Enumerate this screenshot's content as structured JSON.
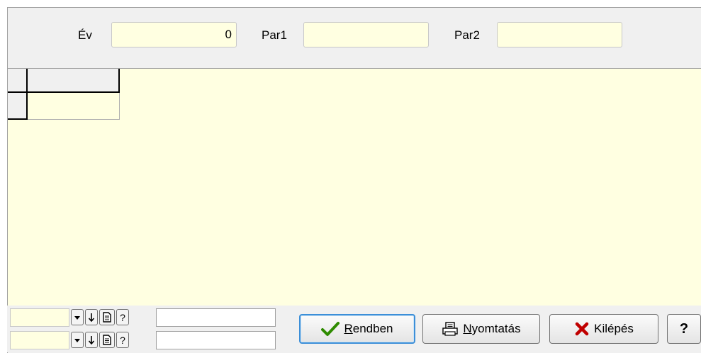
{
  "filters": {
    "ev_label": "Év",
    "ev_value": "0",
    "par1_label": "Par1",
    "par1_value": "",
    "par2_label": "Par2",
    "par2_value": ""
  },
  "grid": {
    "header": "",
    "rows": [
      ""
    ]
  },
  "footer_controls": {
    "row1": {
      "value": "",
      "text": "",
      "buttons": [
        "▾",
        "↓",
        "doc",
        "?"
      ]
    },
    "row2": {
      "value": "",
      "text": "",
      "buttons": [
        "▾",
        "↓",
        "doc",
        "?"
      ]
    }
  },
  "buttons": {
    "ok_mnemonic": "R",
    "ok_rest": "endben",
    "print_mnemonic": "N",
    "print_rest": "yomtatás",
    "exit_label": "Kilépés",
    "help_label": "?"
  },
  "colors": {
    "field_bg": "#ffffe1",
    "window_bg": "#f0f0f0",
    "ok_check": "#2e8b00",
    "exit_x": "#c00000"
  }
}
